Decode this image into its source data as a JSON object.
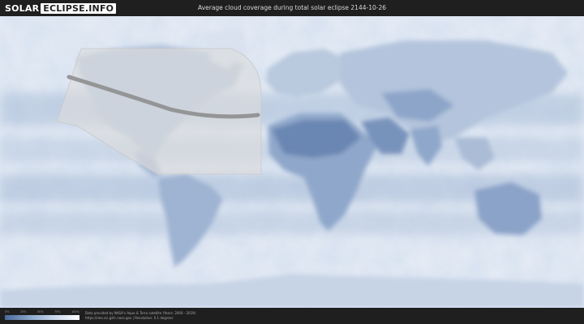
{
  "header": {
    "logo_solar": "SOLAR",
    "logo_eclipse": "ECLIPSE.INFO",
    "title": "Average cloud coverage during total solar eclipse 2144-10-26"
  },
  "legend": {
    "ticks": [
      "0%",
      "25%",
      "50%",
      "75%",
      "100%"
    ],
    "colors": [
      "#4a6a9a",
      "#8aa6cc",
      "#c8d6ea",
      "#ffffff"
    ]
  },
  "footer": {
    "credit_line1": "Data provided by NASA's Aqua & Terra satellite (Years: 2000 - 2019)",
    "credit_line2": "https://neo.sci.gsfc.nasa.gov | Resolution: 0.1 degrees"
  },
  "colors": {
    "background": "#1f1f1f",
    "cloud_clear": "#4a6a9a",
    "cloud_full": "#ffffff",
    "eclipse_path": "#8a8a8a",
    "visibility_zone": "#d8d8d8"
  }
}
